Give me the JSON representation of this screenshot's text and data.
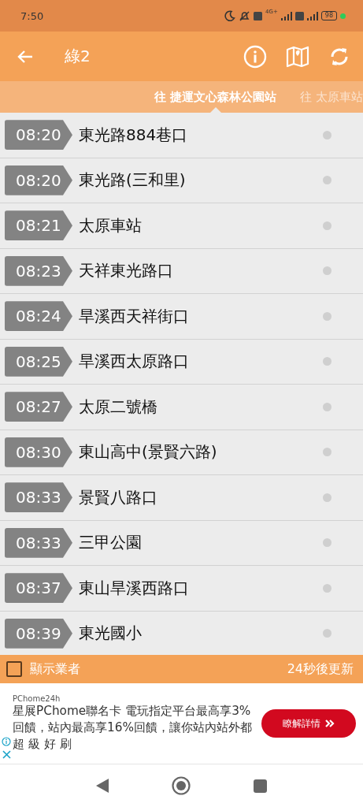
{
  "status_bar": {
    "time": "7:50",
    "network": "4G+",
    "battery": "98"
  },
  "header": {
    "title": "綠2"
  },
  "tabs": [
    {
      "label": "往  捷運文心森林公園站",
      "selected": true
    },
    {
      "label": "往  太原車站",
      "selected": false
    }
  ],
  "stops": [
    {
      "time": "08:20",
      "name": "東光路884巷口"
    },
    {
      "time": "08:20",
      "name": "東光路(三和里)"
    },
    {
      "time": "08:21",
      "name": "太原車站"
    },
    {
      "time": "08:23",
      "name": "天祥東光路口"
    },
    {
      "time": "08:24",
      "name": "旱溪西天祥街口"
    },
    {
      "time": "08:25",
      "name": "旱溪西太原路口"
    },
    {
      "time": "08:27",
      "name": "太原二號橋"
    },
    {
      "time": "08:30",
      "name": "東山高中(景賢六路)"
    },
    {
      "time": "08:33",
      "name": "景賢八路口"
    },
    {
      "time": "08:33",
      "name": "三甲公園"
    },
    {
      "time": "08:37",
      "name": "東山旱溪西路口"
    },
    {
      "time": "08:39",
      "name": "東光國小"
    }
  ],
  "footer": {
    "show_operator": {
      "label": "顯示業者",
      "checked": false
    },
    "refresh": "24秒後更新"
  },
  "ad": {
    "advertiser": "PChome24h",
    "text": "星展PChome聯名卡 電玩指定平台最高享3%回饋，站內最高享16%回饋，讓你站內站外都超 級 好 刷",
    "button": "瞭解詳情"
  }
}
